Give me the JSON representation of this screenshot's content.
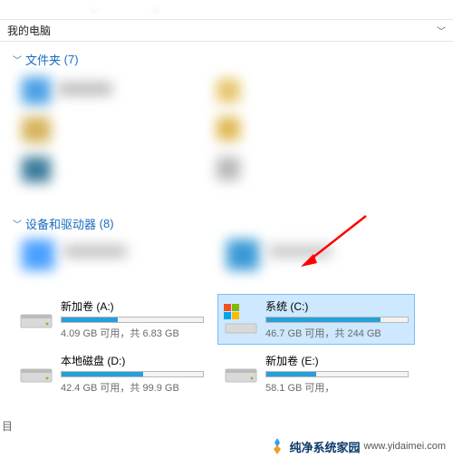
{
  "location": {
    "title": "我的电脑"
  },
  "sections": {
    "folders": {
      "label": "文件夹",
      "count": "(7)"
    },
    "devices": {
      "label": "设备和驱动器",
      "count": "(8)"
    }
  },
  "drives": [
    {
      "name": "新加卷 (A:)",
      "free": "4.09 GB 可用，共 6.83 GB",
      "fill": 40,
      "selected": false,
      "os": false
    },
    {
      "name": "系统 (C:)",
      "free": "46.7 GB 可用，共 244 GB",
      "fill": 81,
      "selected": true,
      "os": true
    },
    {
      "name": "本地磁盘 (D:)",
      "free": "42.4 GB 可用，共 99.9 GB",
      "fill": 58,
      "selected": false,
      "os": false
    },
    {
      "name": "新加卷 (E:)",
      "free": "58.1 GB 可用，",
      "fill": 35,
      "selected": false,
      "os": false
    }
  ],
  "bottom": {
    "brand": "纯净系统家园",
    "url": "www.yidaimei.com"
  },
  "status_left": "目"
}
